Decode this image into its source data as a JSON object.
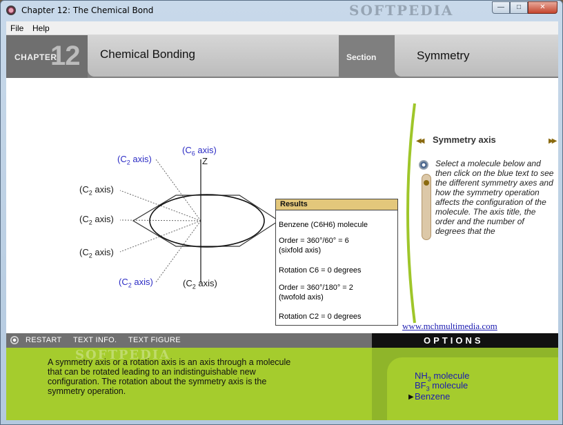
{
  "window": {
    "title": "Chapter 12: The Chemical Bond",
    "watermark": "SOFTPEDIA"
  },
  "menu": {
    "file": "File",
    "help": "Help"
  },
  "header": {
    "chapter_label": "CHAPTER",
    "chapter_number": "12",
    "title": "Chemical Bonding",
    "section_label": "Section",
    "section_title": "Symmetry"
  },
  "diagram": {
    "c6_prefix": "(C",
    "c6_sub": "6",
    "c6_suffix": " axis)",
    "z_label": "Z",
    "c2_prefix": "(C",
    "c2_sub": "2",
    "c2_suffix": " axis)"
  },
  "results": {
    "heading": "Results",
    "molecule": "Benzene (C6H6) molecule",
    "order6": "Order = 360°/60° = 6",
    "order6_note": "(sixfold axis)",
    "rot6": "Rotation C6 =  0 degrees",
    "order2": "Order = 360°/180° = 2",
    "order2_note": "(twofold axis)",
    "rot2": "Rotation C2 =  0 degrees"
  },
  "panel": {
    "title": "Symmetry axis",
    "text": "Select a molecule below and then click on the blue text to see the different symmetry axes and how the symmetry operation affects the configuration of the molecule. The axis title, the order and the number of degrees that the"
  },
  "link": "www.mchmultimedia.com",
  "toolbar": {
    "restart": "RESTART",
    "text_info": "TEXT INFO.",
    "text_figure": "TEXT FIGURE"
  },
  "options": {
    "title": "OPTIONS",
    "nh3_a": "NH",
    "nh3_sub": "3",
    "nh3_b": " molecule",
    "bf3_a": "BF",
    "bf3_sub": "3",
    "bf3_b": " molecule",
    "benzene": "Benzene"
  },
  "description": "A symmetry axis or a rotation axis is an axis through a molecule that can be rotated leading to an indistinguishable new configuration. The rotation about the symmetry axis is the symmetry operation."
}
